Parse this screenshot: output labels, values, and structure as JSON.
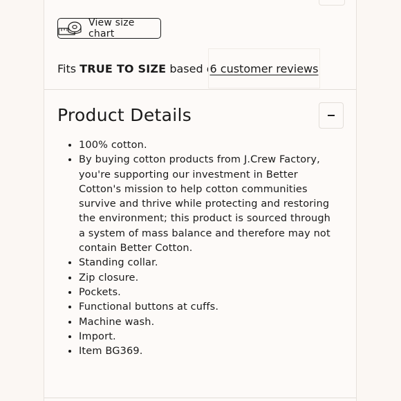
{
  "size_chart": {
    "icon": "tape-measure-icon",
    "label": "View size chart"
  },
  "fit": {
    "prefix": "Fits",
    "emphasis": "TRUE TO SIZE",
    "suffix": "based on",
    "reviews_link": "6 customer reviews"
  },
  "product_details": {
    "title": "Product Details",
    "toggle_symbol": "-",
    "items": [
      "100% cotton.",
      "By buying cotton products from J.Crew Factory, you're supporting our investment in Better Cotton's mission to help cotton communities survive and thrive while protecting and restoring the environment; this product is sourced through a system of mass balance and therefore may not contain Better Cotton.",
      "Standing collar.",
      "Zip closure.",
      "Pockets.",
      "Functional buttons at cuffs.",
      "Machine wash.",
      "Import.",
      "Item BG369."
    ]
  },
  "colors": {
    "page_bg": "#fbf7f3",
    "panel_bg": "#fdfaf8",
    "text": "#1a1a1a",
    "border": "#e2ddd8"
  }
}
